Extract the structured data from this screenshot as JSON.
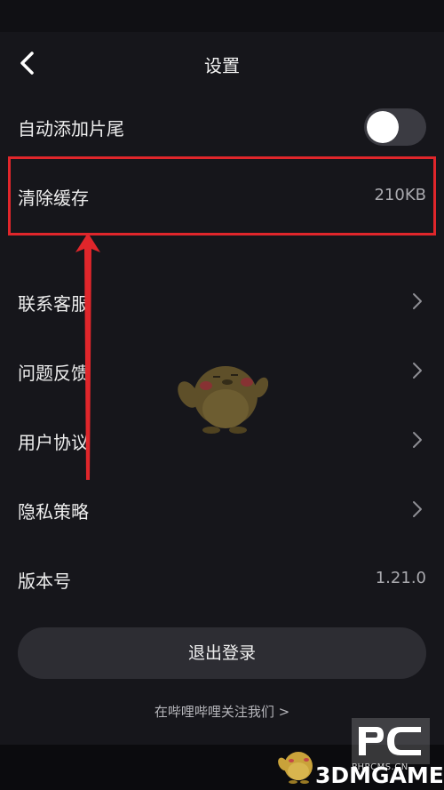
{
  "nav": {
    "title": "设置"
  },
  "settings": {
    "auto_outro_label": "自动添加片尾",
    "clear_cache_label": "清除缓存",
    "clear_cache_size": "210KB",
    "contact_support_label": "联系客服",
    "feedback_label": "问题反馈",
    "user_agreement_label": "用户协议",
    "privacy_policy_label": "隐私策略",
    "version_label": "版本号",
    "version_value": "1.21.0"
  },
  "toggle": {
    "auto_outro_on": false
  },
  "actions": {
    "logout_label": "退出登录",
    "follow_label": "在哔哩哔哩关注我们 >"
  },
  "watermark": {
    "pc_text": "PC",
    "site_text": "PHPCMS.CN",
    "brand_text": "3DMGAME"
  },
  "colors": {
    "background": "#16161b",
    "highlight": "#e0262b",
    "button": "#2d2d33"
  },
  "icons": {
    "back": "chevron-left-icon",
    "row_arrow": "chevron-right-icon"
  }
}
